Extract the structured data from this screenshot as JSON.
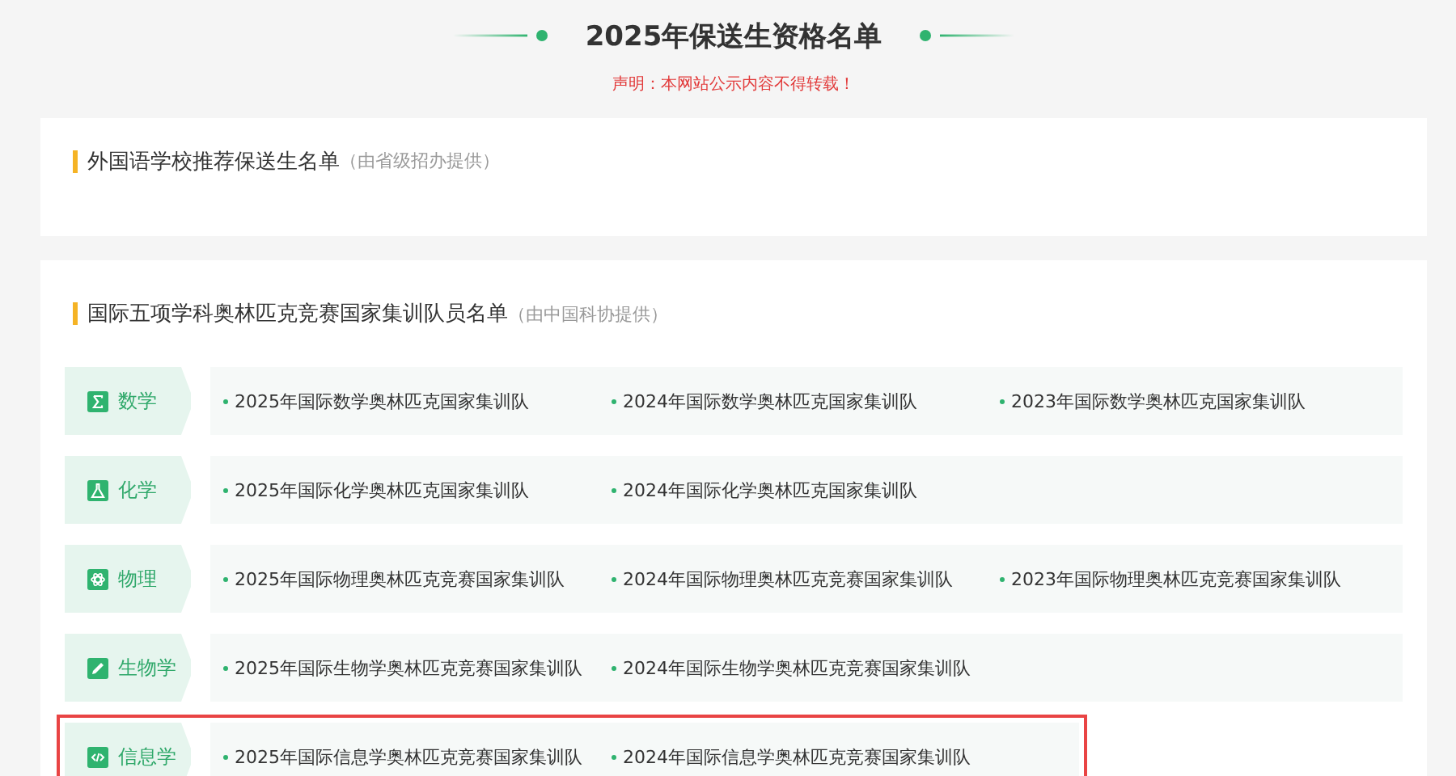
{
  "page_title": "2025年保送生资格名单",
  "notice": "声明：本网站公示内容不得转载！",
  "sections": [
    {
      "title": "外国语学校推荐保送生名单",
      "source": "（由省级招办提供）"
    },
    {
      "title": "国际五项学科奥林匹克竞赛国家集训队员名单",
      "source": "（由中国科协提供）",
      "subjects": [
        {
          "kind": "math",
          "name": "数学",
          "highlighted": false,
          "links": [
            "2025年国际数学奥林匹克国家集训队",
            "2024年国际数学奥林匹克国家集训队",
            "2023年国际数学奥林匹克国家集训队"
          ]
        },
        {
          "kind": "chemistry",
          "name": "化学",
          "highlighted": false,
          "links": [
            "2025年国际化学奥林匹克国家集训队",
            "2024年国际化学奥林匹克国家集训队"
          ]
        },
        {
          "kind": "physics",
          "name": "物理",
          "highlighted": false,
          "links": [
            "2025年国际物理奥林匹克竞赛国家集训队",
            "2024年国际物理奥林匹克竞赛国家集训队",
            "2023年国际物理奥林匹克竞赛国家集训队"
          ]
        },
        {
          "kind": "biology",
          "name": "生物学",
          "highlighted": false,
          "links": [
            "2025年国际生物学奥林匹克竞赛国家集训队",
            "2024年国际生物学奥林匹克竞赛国家集训队"
          ]
        },
        {
          "kind": "informatics",
          "name": "信息学",
          "highlighted": true,
          "links": [
            "2025年国际信息学奥林匹克竞赛国家集训队",
            "2024年国际信息学奥林匹克竞赛国家集训队"
          ]
        }
      ]
    }
  ]
}
